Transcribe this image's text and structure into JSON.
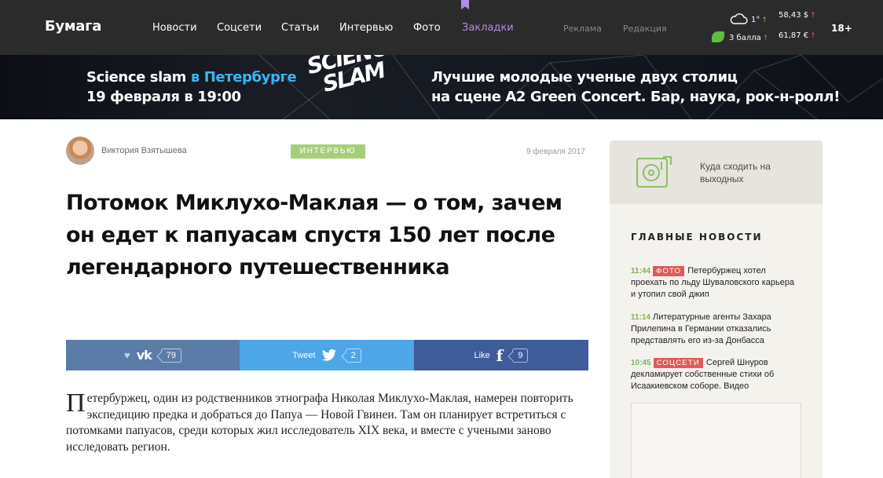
{
  "header": {
    "logo": "Бумага",
    "nav": [
      {
        "label": "Новости"
      },
      {
        "label": "Соцсети"
      },
      {
        "label": "Статьи"
      },
      {
        "label": "Интервью"
      },
      {
        "label": "Фото"
      },
      {
        "label": "Закладки"
      }
    ],
    "secondary_nav": [
      {
        "label": "Реклама"
      },
      {
        "label": "Редакция"
      }
    ],
    "weather": "1°",
    "traffic": "3 балла",
    "usd": "58,43 $",
    "eur": "61,87 €",
    "age_rating": "18+",
    "accent_color": "#b48be0"
  },
  "banner": {
    "event_name": "Science slam",
    "event_city": "в Петербурге",
    "event_date": "19 февраля в 19:00",
    "logo_line1": "SCIENCE",
    "logo_line2": "SLAM",
    "tagline_1": "Лучшие молодые ученые двух столиц",
    "tagline_2": "на сцене A2 Green Concert. Бар, наука, рок-н-ролл!"
  },
  "article": {
    "author": "Виктория Взятышева",
    "category": "ИНТЕРВЬЮ",
    "date": "9 февраля 2017",
    "title": "Потомок Миклухо-Маклая — о том, зачем он едет к папуасам спустя 150 лет после легендарного путешественника",
    "lead_first_letter": "П",
    "lead_rest": "етербуржец, один из родственников этнографа Николая Миклухо-Маклая, намерен повторить экспедицию предка и добраться до Папуа — Новой Гвинеи. Там он планирует встретиться с потомками папуасов, среди которых жил исследователь XIX века, и вместе с учеными заново исследовать регион."
  },
  "share": {
    "vk": {
      "count": "79"
    },
    "twitter": {
      "label": "Tweet",
      "count": "2"
    },
    "facebook": {
      "label": "Like",
      "count": "9"
    }
  },
  "sidebar": {
    "promo": "Куда сходить на выходных",
    "section_title": "ГЛАВНЫЕ НОВОСТИ",
    "news": [
      {
        "time": "11:44",
        "badge": "ФОТО",
        "text": "Петербуржец хотел проехать по льду Шуваловского карьера и утопил свой джип"
      },
      {
        "time": "11:14",
        "badge": "",
        "text": "Литературные агенты Захара Прилепина в Германии отказались представлять его из-за Донбасса"
      },
      {
        "time": "10:45",
        "badge": "СОЦСЕТИ",
        "text": "Сергей Шнуров декламирует собственные стихи об Исаакиевском соборе. Видео"
      }
    ]
  }
}
